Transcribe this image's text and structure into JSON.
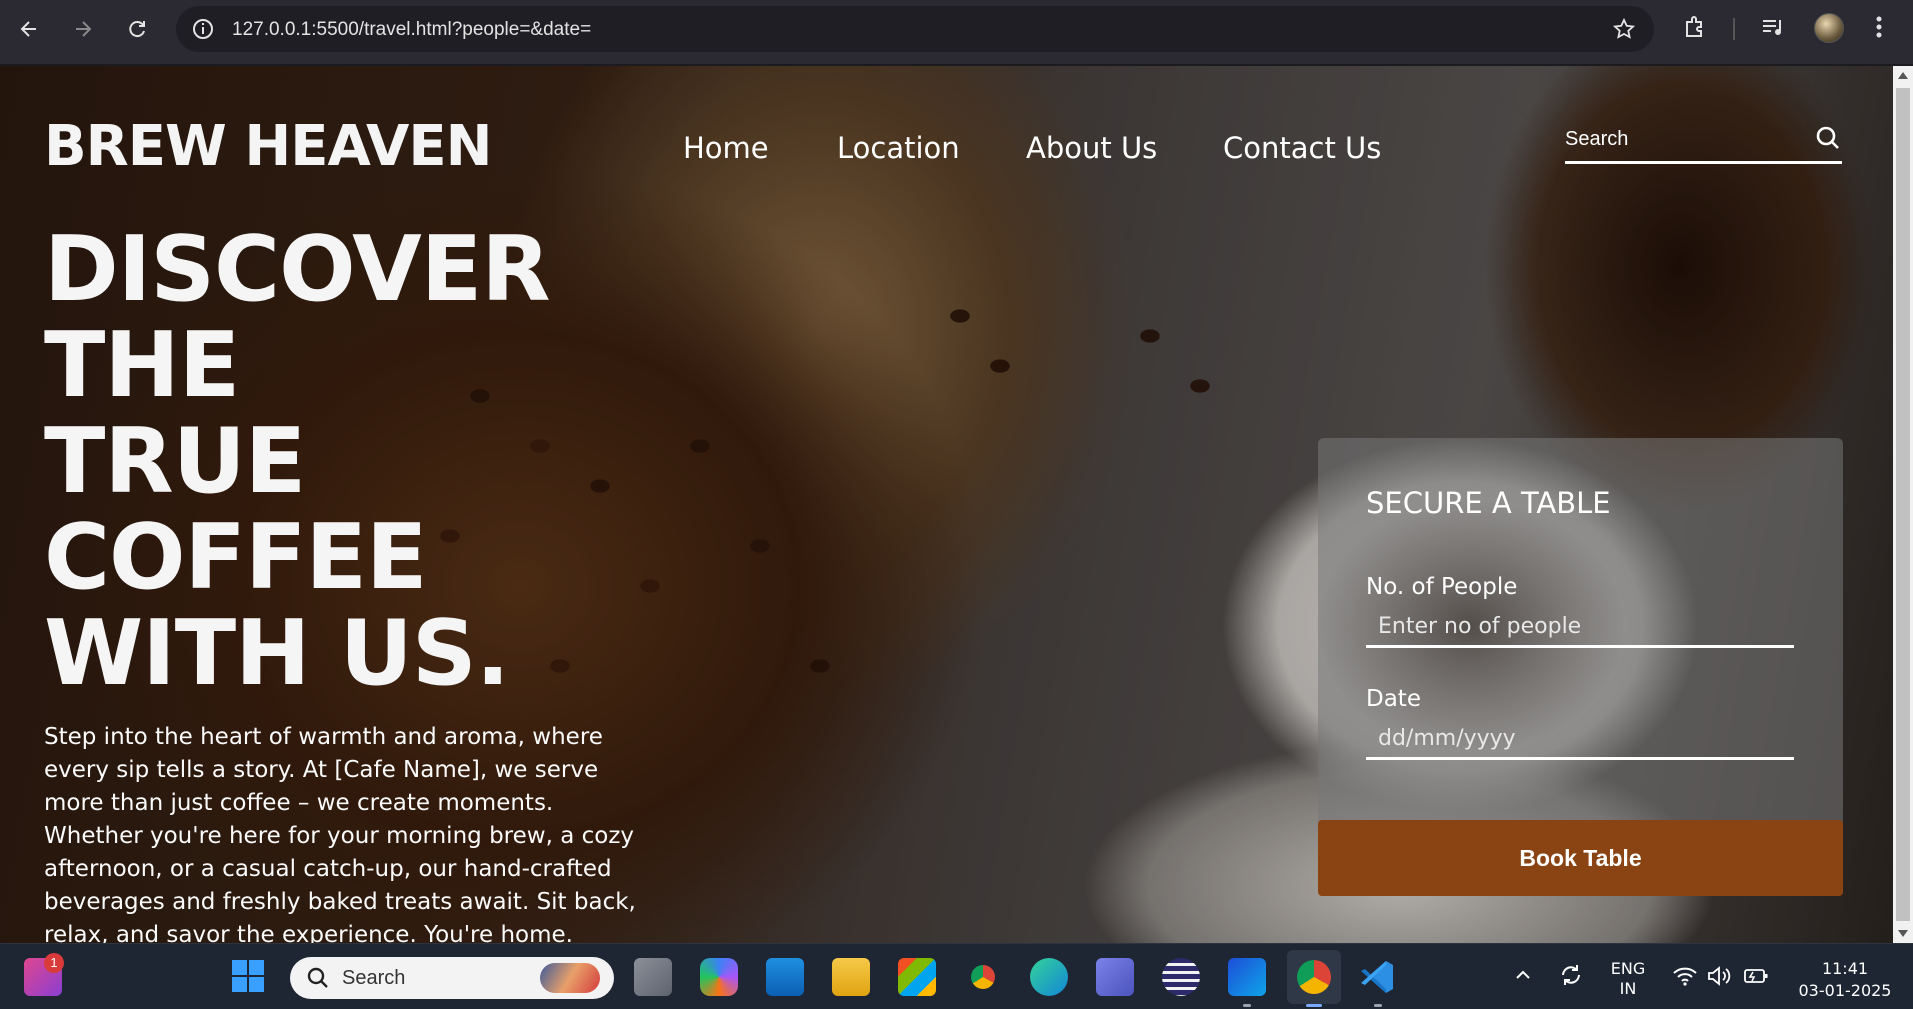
{
  "browser": {
    "url": "127.0.0.1:5500/travel.html?people=&date="
  },
  "site": {
    "brand": "BREW HEAVEN",
    "nav": [
      "Home",
      "Location",
      "About Us",
      "Contact Us"
    ],
    "search_placeholder": "Search",
    "hero_lines": [
      "DISCOVER",
      "THE",
      "TRUE",
      "COFFEE",
      "WITH US."
    ],
    "paragraph": "Step into the heart of warmth and aroma, where every sip tells a story. At [Cafe Name], we serve more than just coffee – we create moments. Whether you're here for your morning brew, a cozy afternoon, or a casual catch-up, our hand-crafted beverages and freshly baked treats await. Sit back, relax, and savor the experience. You're home."
  },
  "booking": {
    "title": "SECURE A TABLE",
    "people_label": "No. of People",
    "people_placeholder": "Enter no of people",
    "date_label": "Date",
    "date_placeholder": "dd/mm/yyyy",
    "button": "Book Table"
  },
  "taskbar": {
    "search": "Search",
    "notification_count": "1",
    "lang_top": "ENG",
    "lang_bottom": "IN",
    "time": "11:41",
    "date": "03-01-2025"
  },
  "colors": {
    "accent_button": "#8a4413",
    "chrome_bg": "#2b2a33"
  }
}
